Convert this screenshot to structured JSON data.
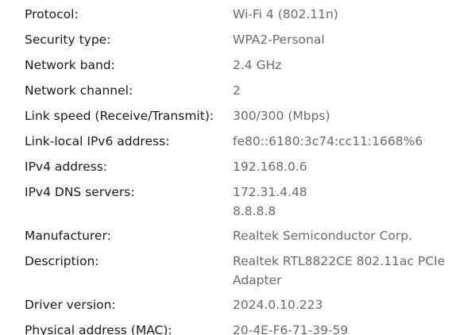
{
  "properties": [
    {
      "label": "Protocol:",
      "value": [
        "Wi-Fi 4 (802.11n)"
      ]
    },
    {
      "label": "Security type:",
      "value": [
        "WPA2-Personal"
      ]
    },
    {
      "label": "Network band:",
      "value": [
        "2.4 GHz"
      ]
    },
    {
      "label": "Network channel:",
      "value": [
        "2"
      ]
    },
    {
      "label": "Link speed (Receive/Transmit):",
      "value": [
        "300/300 (Mbps)"
      ]
    },
    {
      "label": "Link-local IPv6 address:",
      "value": [
        "fe80::6180:3c74:cc11:1668%6"
      ]
    },
    {
      "label": "IPv4 address:",
      "value": [
        "192.168.0.6"
      ]
    },
    {
      "label": "IPv4 DNS servers:",
      "value": [
        "172.31.4.48",
        "8.8.8.8"
      ]
    },
    {
      "label": "Manufacturer:",
      "value": [
        "Realtek Semiconductor Corp."
      ]
    },
    {
      "label": "Description:",
      "value": [
        "Realtek RTL8822CE 802.11ac PCIe",
        "Adapter"
      ]
    },
    {
      "label": "Driver version:",
      "value": [
        "2024.0.10.223"
      ]
    },
    {
      "label": "Physical address (MAC):",
      "value": [
        "20-4E-F6-71-39-59"
      ]
    }
  ]
}
